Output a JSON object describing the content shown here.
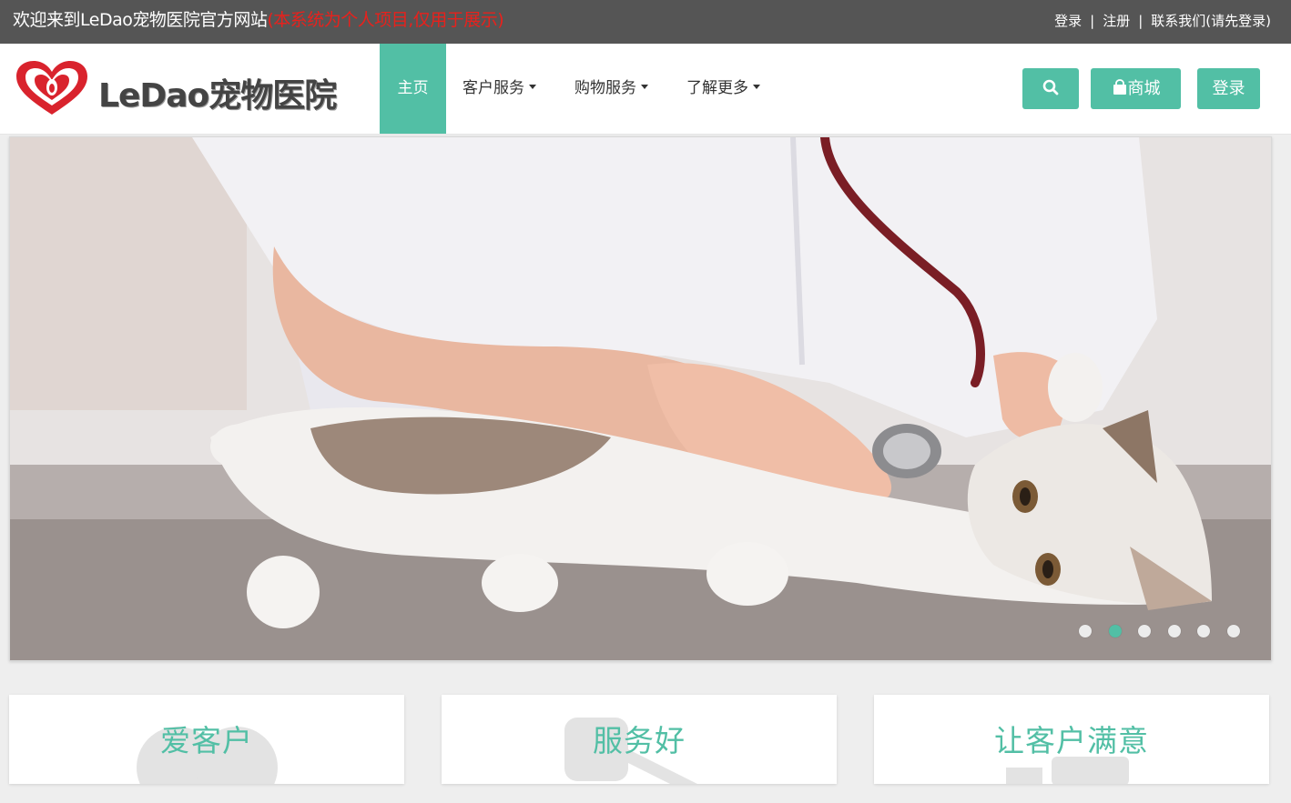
{
  "topbar": {
    "welcome": "欢迎来到LeDao宠物医院官方网站",
    "note": "(本系统为个人项目,仅用于展示)",
    "links": {
      "login": "登录",
      "separator": "|",
      "register": "注册",
      "contact": "联系我们(请先登录)"
    }
  },
  "navbar": {
    "logo_text": "LeDao宠物医院",
    "items": {
      "home": "主页",
      "customer_service": "客户服务",
      "shopping_service": "购物服务",
      "learn_more": "了解更多"
    },
    "buttons": {
      "search_icon": "search-icon",
      "shop": "商城",
      "login": "登录"
    }
  },
  "hero": {
    "slide_count": 6,
    "active_slide": 2
  },
  "features": [
    {
      "title": "爱客户"
    },
    {
      "title": "服务好"
    },
    {
      "title": "让客户满意"
    }
  ],
  "colors": {
    "accent": "#52bfa5",
    "topbar": "#555555",
    "note_red": "#e8211c",
    "logo_red": "#d9232d"
  }
}
